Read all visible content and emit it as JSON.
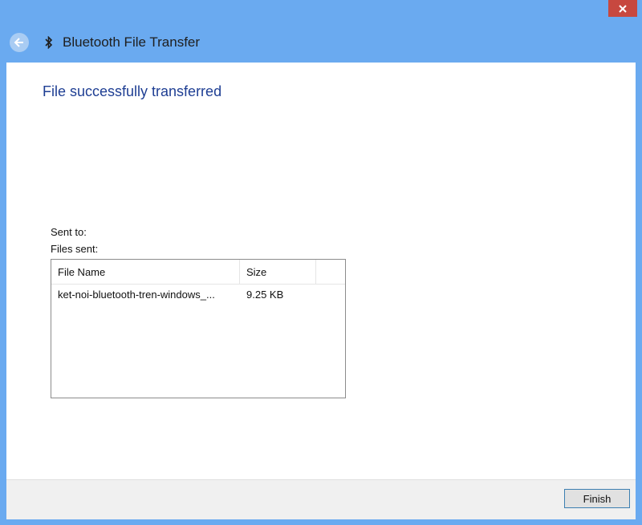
{
  "window": {
    "title": "Bluetooth File Transfer",
    "accent_color": "#6aaaf0",
    "close_icon": "close-icon",
    "back_icon": "back-arrow-icon",
    "title_icon": "bluetooth-icon"
  },
  "content": {
    "heading": "File successfully transferred",
    "sent_to_label": "Sent to:",
    "files_sent_label": "Files sent:",
    "table": {
      "columns": [
        "File Name",
        "Size"
      ],
      "rows": [
        {
          "name": "ket-noi-bluetooth-tren-windows_...",
          "size": "9.25 KB"
        }
      ]
    }
  },
  "footer": {
    "finish_label": "Finish"
  }
}
